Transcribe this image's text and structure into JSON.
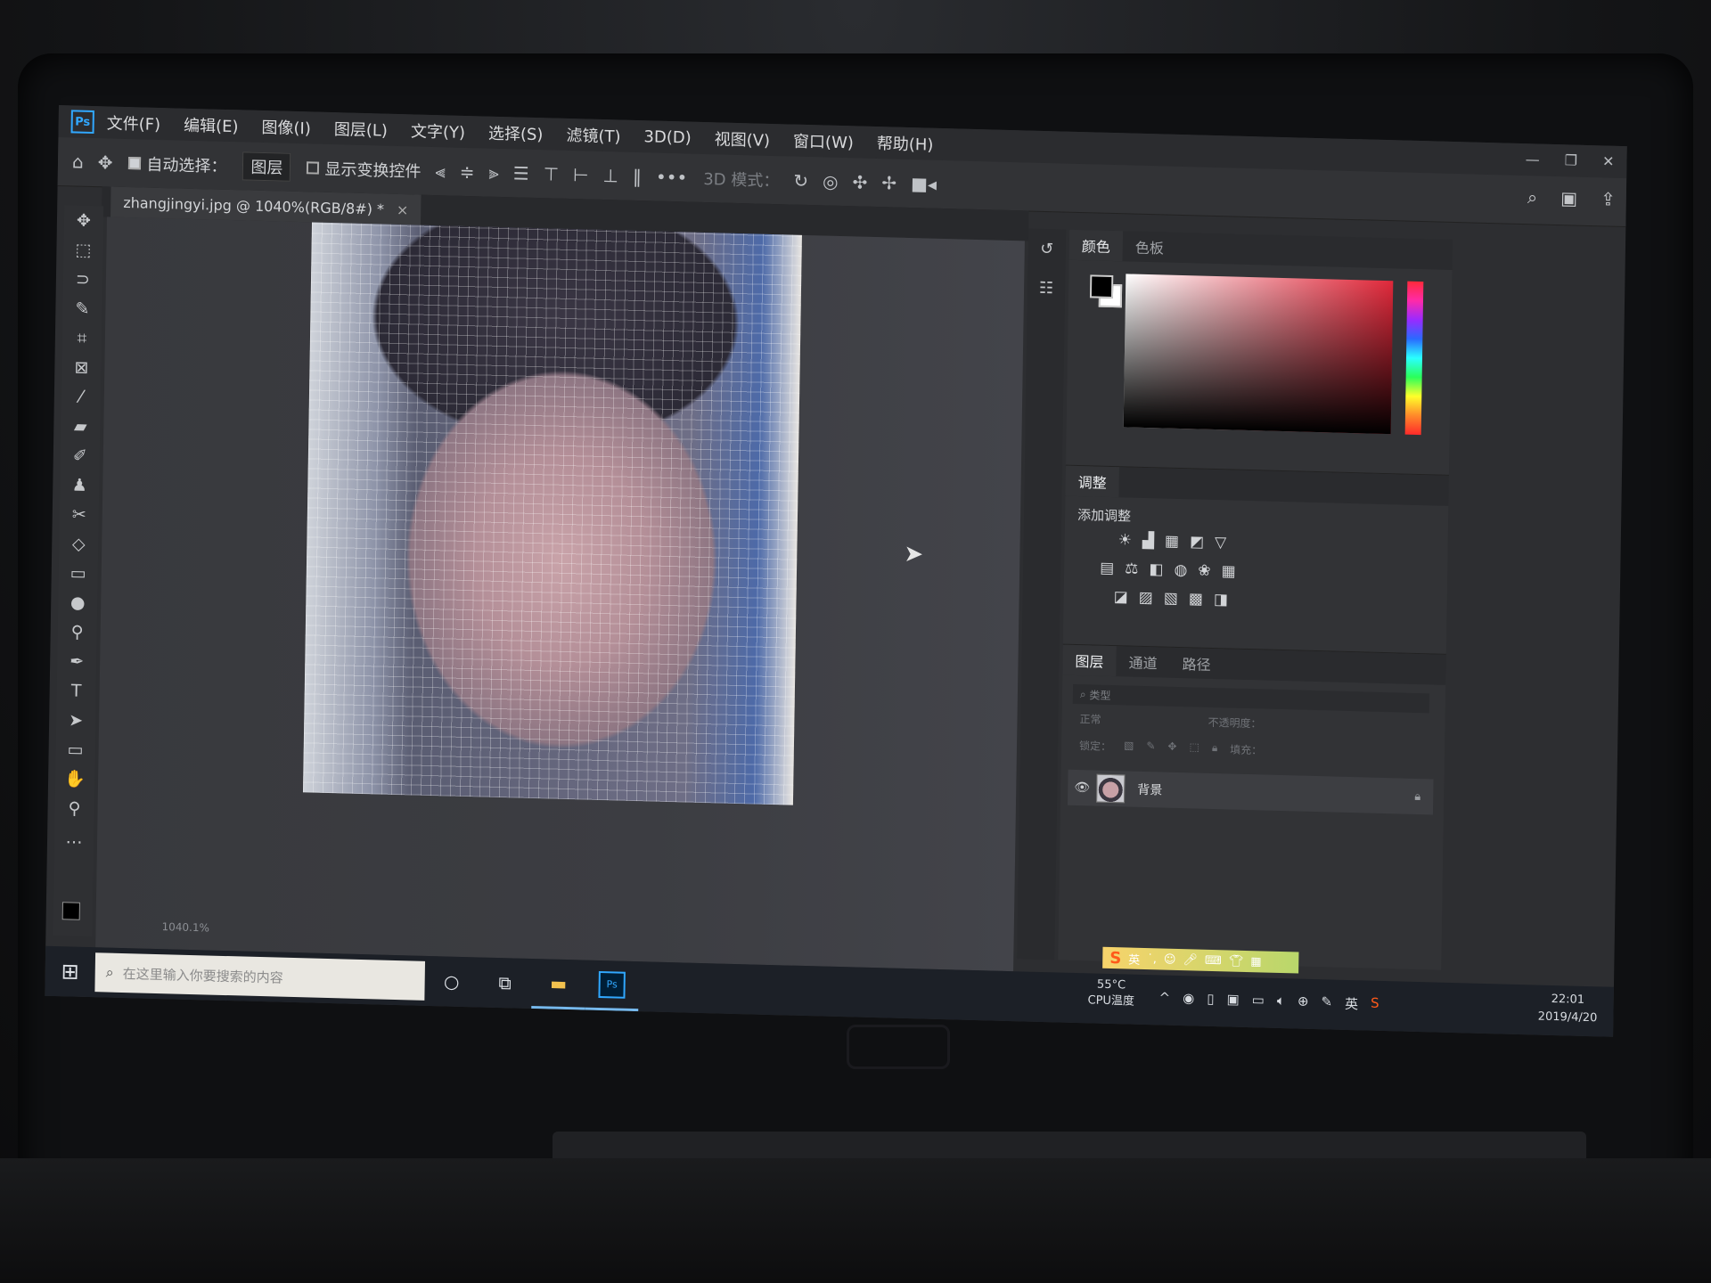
{
  "menu": [
    "文件(F)",
    "编辑(E)",
    "图像(I)",
    "图层(L)",
    "文字(Y)",
    "选择(S)",
    "滤镜(T)",
    "3D(D)",
    "视图(V)",
    "窗口(W)",
    "帮助(H)"
  ],
  "options": {
    "auto_select_label": "自动选择：",
    "auto_select_value": "图层",
    "show_transform_label": "显示变换控件",
    "mode_3d_label": "3D 模式："
  },
  "document": {
    "tab_title": "zhangjingyi.jpg @ 1040%(RGB/8#) *",
    "close": "×",
    "zoom_status": "1040.1%"
  },
  "panels": {
    "color_tabs": [
      "颜色",
      "色板"
    ],
    "adjust_tab": "调整",
    "adjust_title": "添加调整",
    "layers_tabs": [
      "图层",
      "通道",
      "路径"
    ],
    "layer_filter": "类型",
    "blend_mode": "正常",
    "opacity_label": "不透明度：",
    "lock_label": "锁定：",
    "fill_label": "填充：",
    "layer_name": "背景"
  },
  "taskbar": {
    "search_placeholder": "在这里输入你要搜索的内容",
    "cpu_temp": "55°C",
    "cpu_label": "CPU温度",
    "ime_lang": "英",
    "time": "22:01",
    "date": "2019/4/20",
    "ps_badge": "Ps"
  },
  "icons": {
    "accent": "#31a8ff"
  }
}
